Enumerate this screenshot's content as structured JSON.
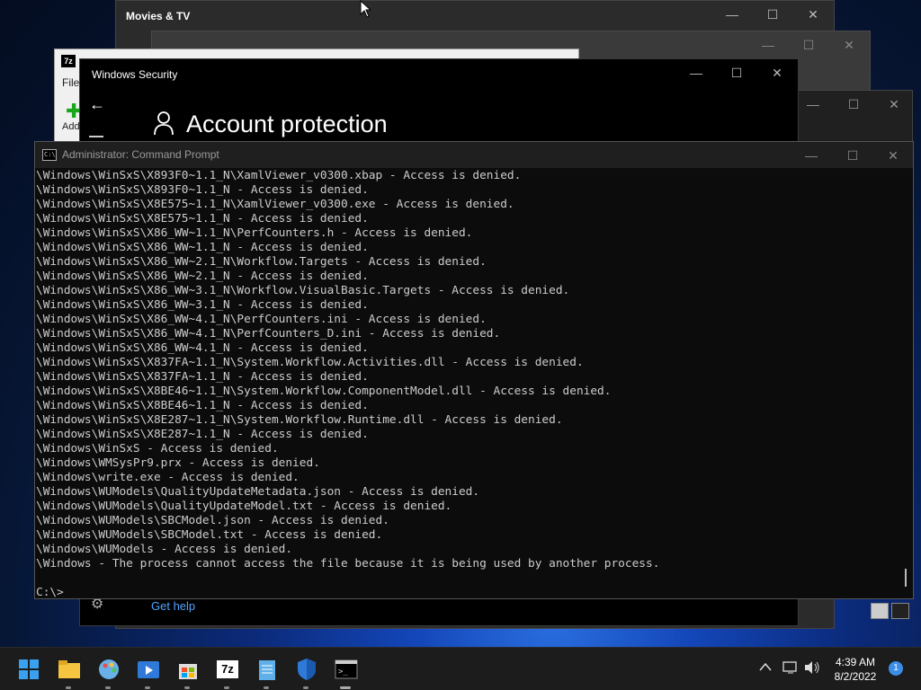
{
  "movies": {
    "title": "Movies & TV"
  },
  "zip": {
    "logo": "7z",
    "menu_file": "File",
    "add_label": "Add"
  },
  "security": {
    "title": "Windows Security",
    "heading": "Account protection",
    "get_help": "Get help"
  },
  "cmd": {
    "title": "Administrator: Command Prompt",
    "icon_text": "C:\\",
    "lines": [
      "\\Windows\\WinSxS\\X893F0~1.1_N\\XamlViewer_v0300.xbap - Access is denied.",
      "\\Windows\\WinSxS\\X893F0~1.1_N - Access is denied.",
      "\\Windows\\WinSxS\\X8E575~1.1_N\\XamlViewer_v0300.exe - Access is denied.",
      "\\Windows\\WinSxS\\X8E575~1.1_N - Access is denied.",
      "\\Windows\\WinSxS\\X86_WW~1.1_N\\PerfCounters.h - Access is denied.",
      "\\Windows\\WinSxS\\X86_WW~1.1_N - Access is denied.",
      "\\Windows\\WinSxS\\X86_WW~2.1_N\\Workflow.Targets - Access is denied.",
      "\\Windows\\WinSxS\\X86_WW~2.1_N - Access is denied.",
      "\\Windows\\WinSxS\\X86_WW~3.1_N\\Workflow.VisualBasic.Targets - Access is denied.",
      "\\Windows\\WinSxS\\X86_WW~3.1_N - Access is denied.",
      "\\Windows\\WinSxS\\X86_WW~4.1_N\\PerfCounters.ini - Access is denied.",
      "\\Windows\\WinSxS\\X86_WW~4.1_N\\PerfCounters_D.ini - Access is denied.",
      "\\Windows\\WinSxS\\X86_WW~4.1_N - Access is denied.",
      "\\Windows\\WinSxS\\X837FA~1.1_N\\System.Workflow.Activities.dll - Access is denied.",
      "\\Windows\\WinSxS\\X837FA~1.1_N - Access is denied.",
      "\\Windows\\WinSxS\\X8BE46~1.1_N\\System.Workflow.ComponentModel.dll - Access is denied.",
      "\\Windows\\WinSxS\\X8BE46~1.1_N - Access is denied.",
      "\\Windows\\WinSxS\\X8E287~1.1_N\\System.Workflow.Runtime.dll - Access is denied.",
      "\\Windows\\WinSxS\\X8E287~1.1_N - Access is denied.",
      "\\Windows\\WinSxS - Access is denied.",
      "\\Windows\\WMSysPr9.prx - Access is denied.",
      "\\Windows\\write.exe - Access is denied.",
      "\\Windows\\WUModels\\QualityUpdateMetadata.json - Access is denied.",
      "\\Windows\\WUModels\\QualityUpdateModel.txt - Access is denied.",
      "\\Windows\\WUModels\\SBCModel.json - Access is denied.",
      "\\Windows\\WUModels\\SBCModel.txt - Access is denied.",
      "\\Windows\\WUModels - Access is denied.",
      "\\Windows - The process cannot access the file because it is being used by another process.",
      "",
      "C:\\>"
    ]
  },
  "taskbar": {
    "apps": [
      {
        "name": "start-button",
        "icon": "windows-logo-icon"
      },
      {
        "name": "file-explorer",
        "icon": "folder-icon"
      },
      {
        "name": "paint",
        "icon": "palette-icon"
      },
      {
        "name": "movies-tv",
        "icon": "movies-icon"
      },
      {
        "name": "store",
        "icon": "store-icon"
      },
      {
        "name": "7zip",
        "icon": "7zip-icon",
        "label": "7z"
      },
      {
        "name": "notepad",
        "icon": "notepad-icon"
      },
      {
        "name": "windows-security",
        "icon": "shield-icon"
      },
      {
        "name": "command-prompt",
        "icon": "terminal-icon"
      }
    ],
    "time": "4:39 AM",
    "date": "8/2/2022",
    "notification_count": "1"
  },
  "colors": {
    "accent": "#3b8ee8",
    "link": "#4ea3ff",
    "console_text": "#cccccc"
  }
}
